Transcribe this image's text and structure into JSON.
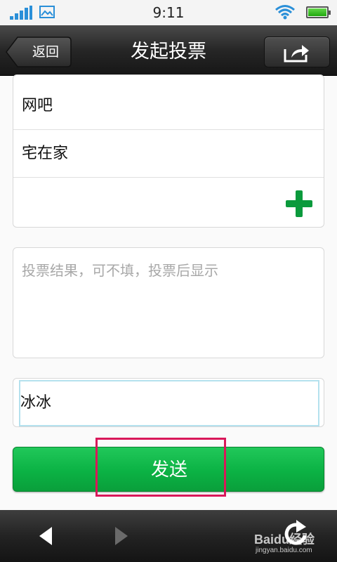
{
  "status_bar": {
    "time": "9:11",
    "icons": [
      "signal-icon",
      "image-icon",
      "wifi-icon",
      "battery-icon"
    ],
    "accent_color": "#2a8fd8"
  },
  "header": {
    "back_label": "返回",
    "title": "发起投票",
    "share_icon": "share-icon"
  },
  "poll": {
    "options": [
      "网吧",
      "宅在家"
    ],
    "add_icon": "plus-icon",
    "add_color": "#0a9a3c",
    "result_placeholder": "投票结果，可不填，投票后显示",
    "name_value": "冰冰",
    "send_label": "发送",
    "send_color": "#0bb244",
    "highlight_color": "#d9185a"
  },
  "bottom_bar": {
    "icons": [
      "back-arrow-icon",
      "forward-arrow-icon",
      "refresh-icon"
    ],
    "watermark_main": "Baidu经验",
    "watermark_sub": "jingyan.baidu.com"
  }
}
